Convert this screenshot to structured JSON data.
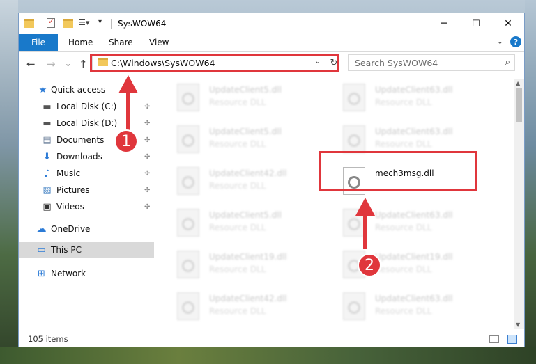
{
  "window": {
    "title": "SysWOW64",
    "minimize": "─",
    "maximize": "☐",
    "close": "✕"
  },
  "ribbon": {
    "file": "File",
    "tabs": [
      "Home",
      "Share",
      "View"
    ],
    "help": "?",
    "collapse": "⌄"
  },
  "nav": {
    "back": "←",
    "forward": "→",
    "recent": "⌄",
    "up": "↑",
    "address": "C:\\Windows\\SysWOW64",
    "address_drop": "⌄",
    "refresh": "↻",
    "search_placeholder": "Search SysWOW64",
    "search_icon": "⌕"
  },
  "sidebar": {
    "items": [
      {
        "label": "Quick access",
        "icon": "star-icon",
        "glyph": "★",
        "pinned": false
      },
      {
        "label": "Local Disk (C:)",
        "icon": "drive-icon",
        "glyph": "▬",
        "pinned": true
      },
      {
        "label": "Local Disk (D:)",
        "icon": "drive-icon",
        "glyph": "▬",
        "pinned": true
      },
      {
        "label": "Documents",
        "icon": "documents-icon",
        "glyph": "▤",
        "pinned": true
      },
      {
        "label": "Downloads",
        "icon": "download-icon",
        "glyph": "⬇",
        "pinned": true
      },
      {
        "label": "Music",
        "icon": "music-icon",
        "glyph": "♪",
        "pinned": true
      },
      {
        "label": "Pictures",
        "icon": "pictures-icon",
        "glyph": "▧",
        "pinned": true
      },
      {
        "label": "Videos",
        "icon": "videos-icon",
        "glyph": "▣",
        "pinned": true
      },
      {
        "label": "OneDrive",
        "icon": "cloud-icon",
        "glyph": "☁",
        "pinned": false
      },
      {
        "label": "This PC",
        "icon": "computer-icon",
        "glyph": "▭",
        "pinned": false
      },
      {
        "label": "Network",
        "icon": "network-icon",
        "glyph": "⊞",
        "pinned": false
      }
    ],
    "pin_glyph": "📌"
  },
  "files": [
    {
      "name": "UpdateClient5.dll",
      "type": "Resource DLL"
    },
    {
      "name": "UpdateClient63.dll",
      "type": "Resource DLL"
    },
    {
      "name": "UpdateClient5.dll",
      "type": "Resource DLL"
    },
    {
      "name": "UpdateClient63.dll",
      "type": "Resource DLL"
    },
    {
      "name": "UpdateClient42.dll",
      "type": "Resource DLL"
    },
    {
      "name": "mech3msg.dll",
      "type": ""
    },
    {
      "name": "UpdateClient5.dll",
      "type": "Resource DLL"
    },
    {
      "name": "UpdateClient63.dll",
      "type": "Resource DLL"
    },
    {
      "name": "UpdateClient19.dll",
      "type": "Resource DLL"
    },
    {
      "name": "UpdateClient19.dll",
      "type": "Resource DLL"
    },
    {
      "name": "UpdateClient42.dll",
      "type": "Resource DLL"
    },
    {
      "name": "UpdateClient63.dll",
      "type": "Resource DLL"
    }
  ],
  "status": {
    "count": "105 items"
  },
  "annotations": {
    "step1": "1",
    "step2": "2",
    "color": "#e0363c"
  }
}
